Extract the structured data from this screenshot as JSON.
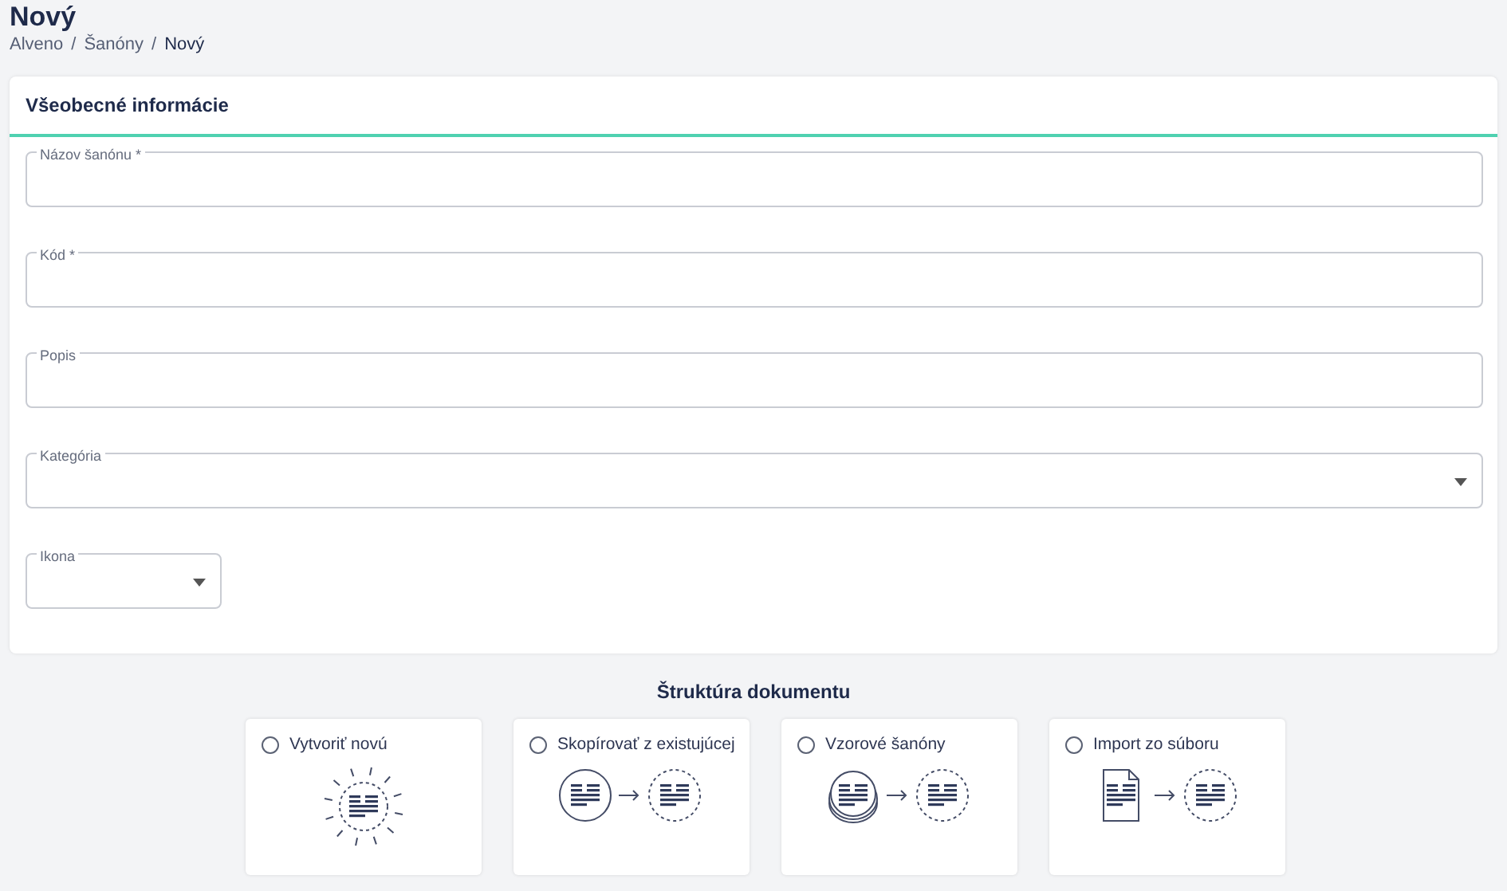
{
  "page": {
    "title": "Nový",
    "breadcrumb": [
      {
        "label": "Alveno",
        "current": false
      },
      {
        "label": "Šanóny",
        "current": false,
        "separator": "/"
      },
      {
        "label": "Nový",
        "current": true,
        "separator": "/"
      }
    ]
  },
  "card": {
    "title": "Všeobecné informácie",
    "fields": [
      {
        "kind": "text",
        "label": "Názov šanónu *"
      },
      {
        "kind": "text",
        "label": "Kód *"
      },
      {
        "kind": "text",
        "label": "Popis"
      },
      {
        "kind": "select",
        "label": "Kategória"
      },
      {
        "kind": "icon-select",
        "label": "Ikona"
      }
    ]
  },
  "structure": {
    "title": "Štruktúra dokumentu",
    "options": [
      {
        "kind": "new",
        "label": "Vytvoriť novú",
        "selected": false
      },
      {
        "kind": "copy",
        "label": "Skopírovať z existujúcej",
        "selected": false
      },
      {
        "kind": "templates",
        "label": "Vzorové šanóny",
        "selected": false
      },
      {
        "kind": "import",
        "label": "Import zo súboru",
        "selected": false
      }
    ]
  }
}
